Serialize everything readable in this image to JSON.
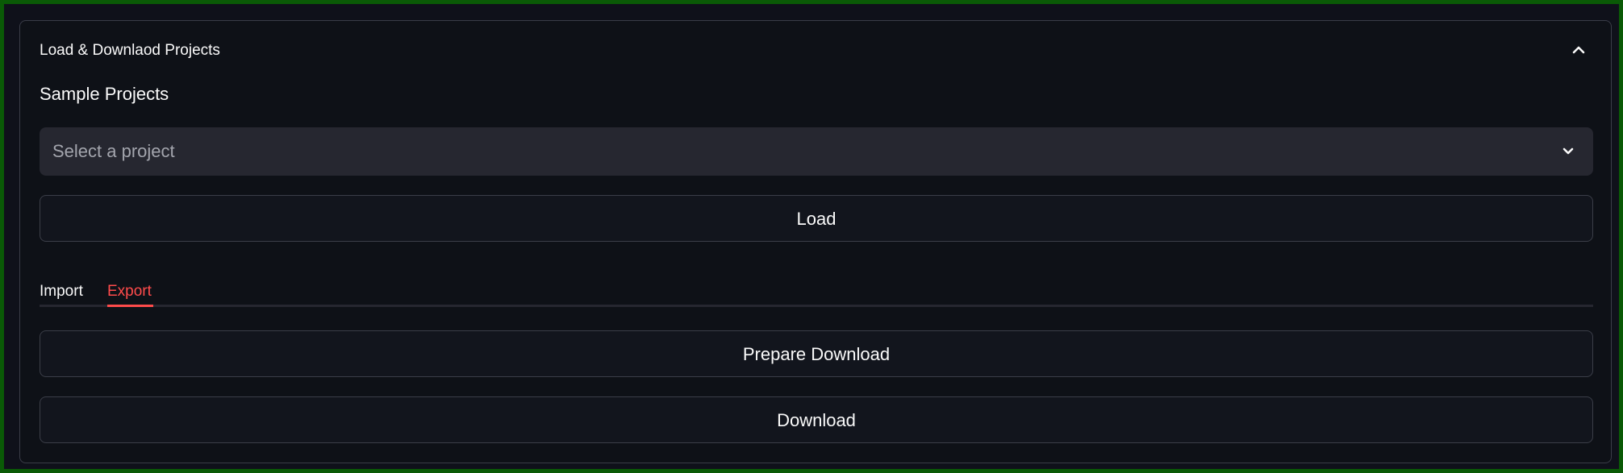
{
  "expander": {
    "title": "Load & Downlaod Projects",
    "collapse_icon": "chevron-up-icon"
  },
  "sample": {
    "label": "Sample Projects",
    "select_placeholder": "Select a project",
    "select_icon": "chevron-down-icon"
  },
  "buttons": {
    "load": "Load",
    "prepare_download": "Prepare Download",
    "download": "Download"
  },
  "tabs": [
    {
      "label": "Import",
      "active": false
    },
    {
      "label": "Export",
      "active": true
    }
  ],
  "colors": {
    "frame_border": "#0a5a06",
    "background": "#0e1117",
    "active_tab": "#ff4b4b",
    "select_bg": "#262730"
  }
}
